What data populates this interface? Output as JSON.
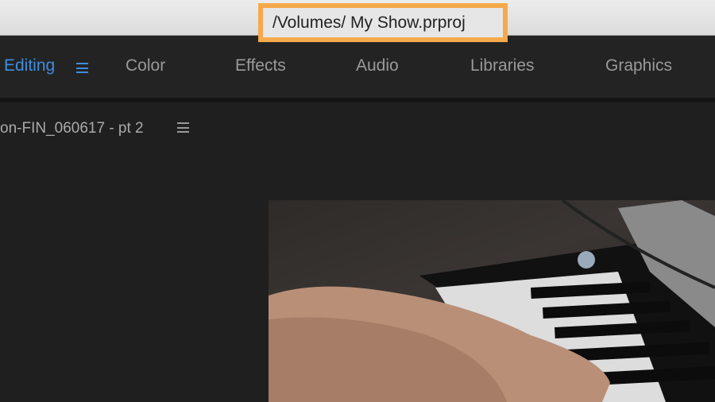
{
  "title_bar": {
    "project_path": "/Volumes/ My Show.prproj",
    "highlight_color": "#f5a94b"
  },
  "workspaces": [
    {
      "label": "Editing",
      "active": true
    },
    {
      "label": "Color",
      "active": false
    },
    {
      "label": "Effects",
      "active": false
    },
    {
      "label": "Audio",
      "active": false
    },
    {
      "label": "Libraries",
      "active": false
    },
    {
      "label": "Graphics",
      "active": false
    }
  ],
  "panel": {
    "sequence_title": "on-FIN_060617 - pt 2"
  },
  "colors": {
    "accent": "#3d8ee0"
  }
}
